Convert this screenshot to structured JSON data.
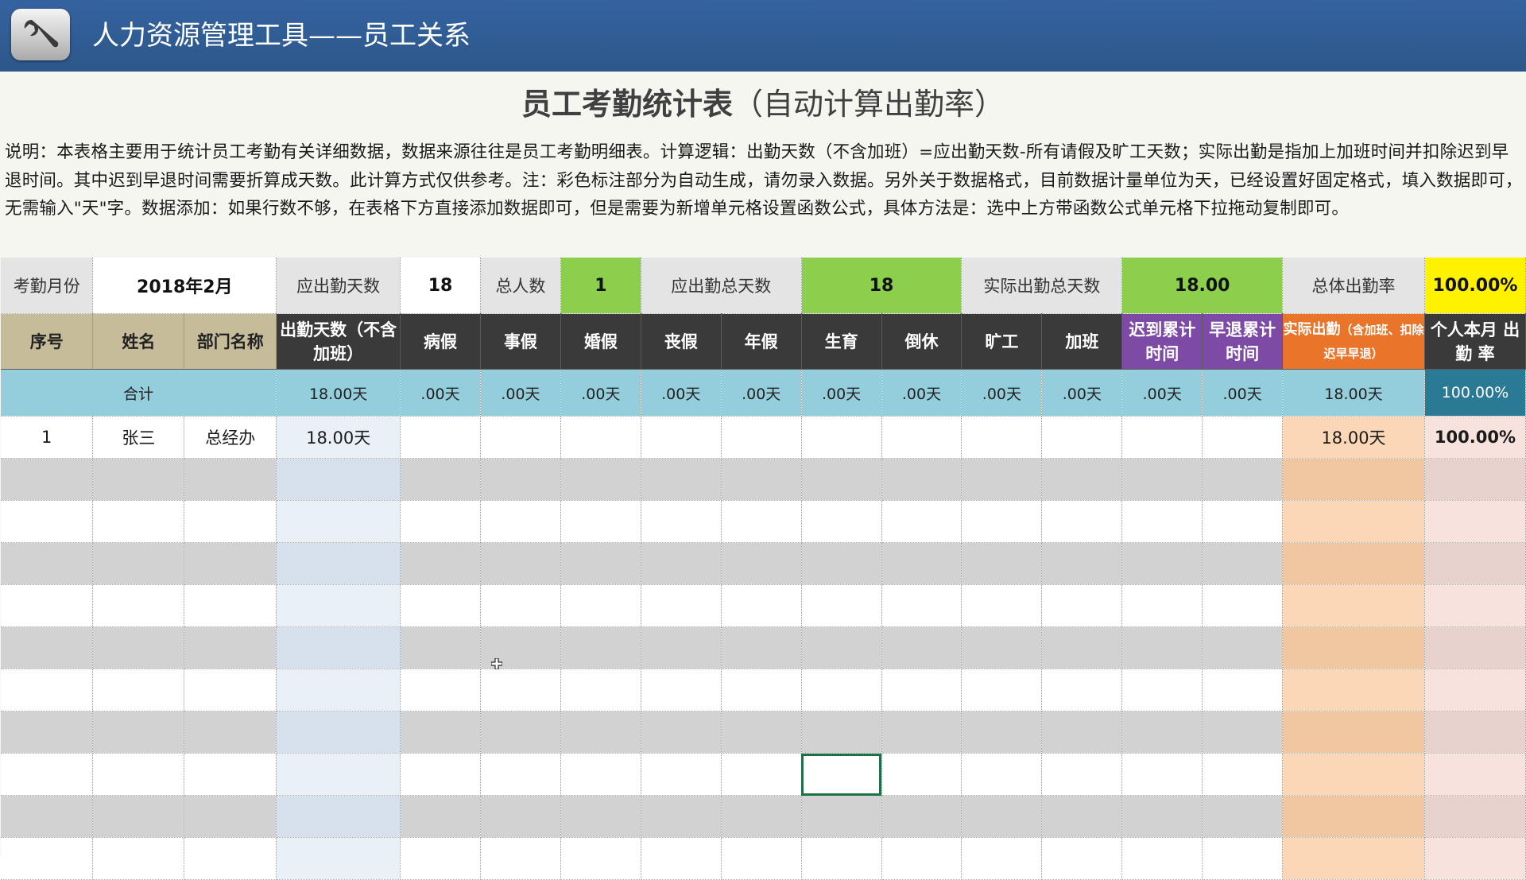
{
  "banner": {
    "title": "人力资源管理工具——员工关系",
    "icon": "wrench-icon"
  },
  "sheet": {
    "title_main": "员工考勤统计表",
    "title_sub": "（自动计算出勤率）",
    "description": "说明：本表格主要用于统计员工考勤有关详细数据，数据来源往往是员工考勤明细表。计算逻辑：出勤天数（不含加班）=应出勤天数-所有请假及旷工天数；实际出勤是指加上加班时间并扣除迟到早退时间。其中迟到早退时间需要折算成天数。此计算方式仅供参考。注：彩色标注部分为自动生成，请勿录入数据。另外关于数据格式，目前数据计量单位为天，已经设置好固定格式，填入数据即可，无需输入\"天\"字。数据添加：如果行数不够，在表格下方直接添加数据即可，但是需要为新增单元格设置函数公式，具体方法是：选中上方带函数公式单元格下拉拖动复制即可。"
  },
  "summary": {
    "month_label": "考勤月份",
    "month_value": "2018年2月",
    "required_days_label": "应出勤天数",
    "required_days_value": "18",
    "headcount_label": "总人数",
    "headcount_value": "1",
    "total_required_label": "应出勤总天数",
    "total_required_value": "18",
    "total_actual_label": "实际出勤总天数",
    "total_actual_value": "18.00",
    "overall_rate_label": "总体出勤率",
    "overall_rate_value": "100.00%"
  },
  "headers": {
    "seq": "序号",
    "name": "姓名",
    "dept": "部门名称",
    "attendance": "出勤天数（不含加班）",
    "sick": "病假",
    "personal": "事假",
    "marriage": "婚假",
    "funeral": "丧假",
    "annual": "年假",
    "maternity": "生育",
    "compensatory": "倒休",
    "absent": "旷工",
    "overtime": "加班",
    "late": "迟到累计时间",
    "early": "早退累计时间",
    "actual_main": "实际出勤",
    "actual_note": "（含加班、扣除迟早早退）",
    "rate": "个人本月 出勤 率"
  },
  "totals": {
    "label": "合计",
    "attendance": "18.00天",
    "sick": ".00天",
    "personal": ".00天",
    "marriage": ".00天",
    "funeral": ".00天",
    "annual": ".00天",
    "maternity": ".00天",
    "compensatory": ".00天",
    "absent": ".00天",
    "overtime": ".00天",
    "late": ".00天",
    "early": ".00天",
    "actual": "18.00天",
    "rate": "100.00%"
  },
  "rows": [
    {
      "seq": "1",
      "name": "张三",
      "dept": "总经办",
      "attendance": "18.00天",
      "actual": "18.00天",
      "rate": "100.00%"
    }
  ]
}
